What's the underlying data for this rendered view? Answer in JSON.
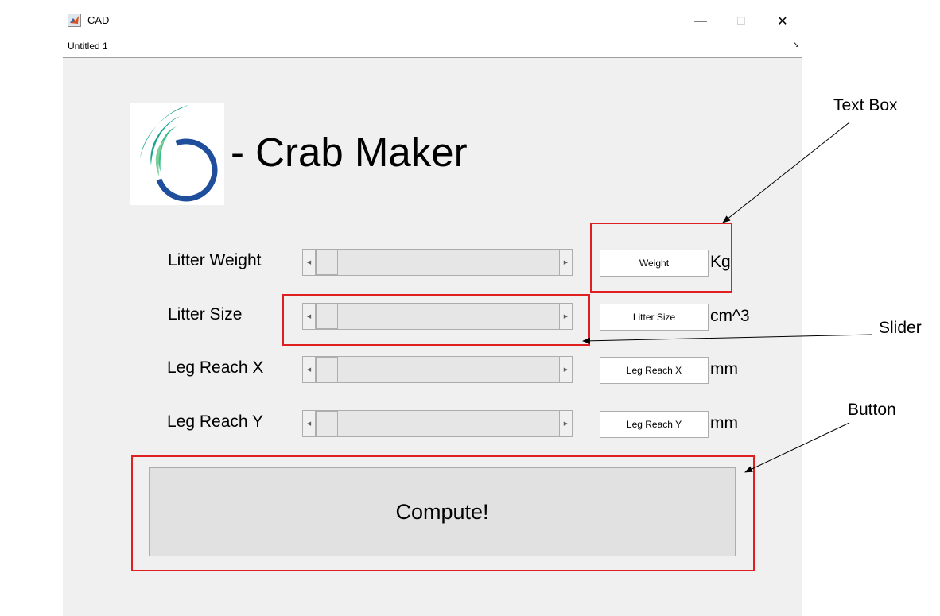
{
  "window": {
    "title": "CAD",
    "icon": "matlab-figure-icon",
    "controls": {
      "minimize": "—",
      "maximize": "☐",
      "close": "✕"
    }
  },
  "toolbar": {
    "label": "Untitled 1",
    "corner_glyph": "↘"
  },
  "app": {
    "heading": "- Crab Maker"
  },
  "rows": [
    {
      "label": "Litter Weight",
      "textbox_value": "Weight",
      "unit": "Kg",
      "slider_value": 0
    },
    {
      "label": "Litter Size",
      "textbox_value": "Litter Size",
      "unit": "cm^3",
      "slider_value": 0
    },
    {
      "label": "Leg Reach X",
      "textbox_value": "Leg Reach X",
      "unit": "mm",
      "slider_value": 0
    },
    {
      "label": "Leg Reach Y",
      "textbox_value": "Leg Reach Y",
      "unit": "mm",
      "slider_value": 0
    }
  ],
  "compute_button": {
    "label": "Compute!"
  },
  "annotations": {
    "text_box": "Text Box",
    "slider": "Slider",
    "button": "Button",
    "color": "#e02020"
  },
  "colors": {
    "panel": "#f0f0f0",
    "logo_teal": "#1aa58c",
    "logo_navy": "#1f4e9c"
  }
}
